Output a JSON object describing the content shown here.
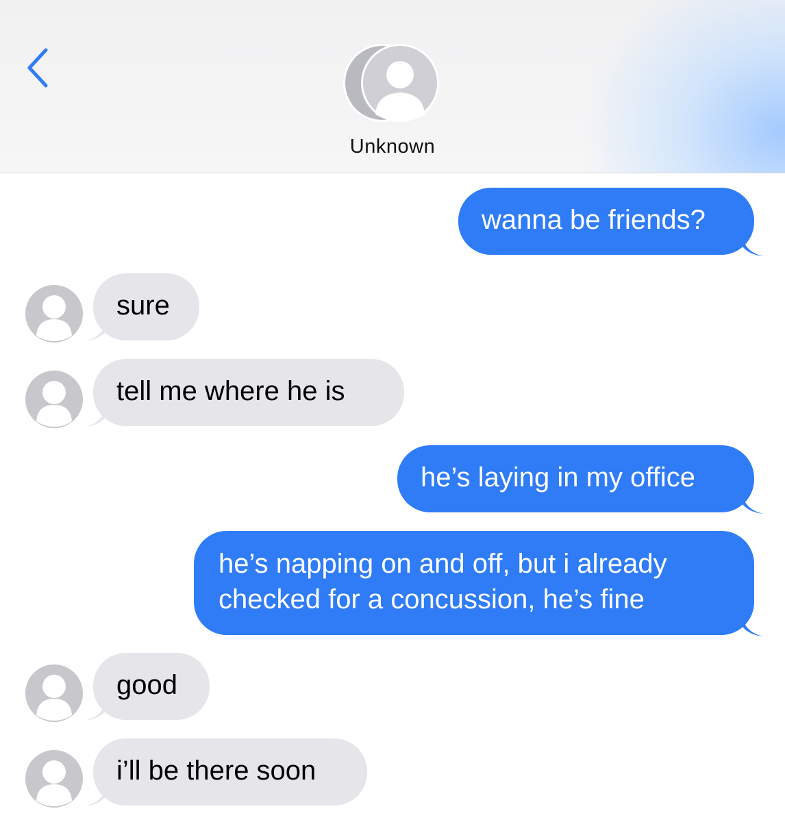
{
  "header": {
    "contact_name": "Unknown",
    "back_icon": "chevron-left-icon",
    "avatar_icon": "group-avatar-icon",
    "accent": "#2f7cf6"
  },
  "messages": [
    {
      "side": "sent",
      "text": "wanna be friends?"
    },
    {
      "side": "received",
      "text": "sure"
    },
    {
      "side": "received",
      "text": "tell me where he is"
    },
    {
      "side": "sent",
      "text": "he’s laying in my office"
    },
    {
      "side": "sent",
      "text": "he’s napping on and off, but i already checked for a concussion, he’s fine"
    },
    {
      "side": "received",
      "text": "good"
    },
    {
      "side": "received",
      "text": "i’ll be there soon"
    }
  ],
  "colors": {
    "sent_bubble": "#2f7cf6",
    "received_bubble": "#e6e6ea",
    "avatar_gray": "#c7c7cc"
  }
}
